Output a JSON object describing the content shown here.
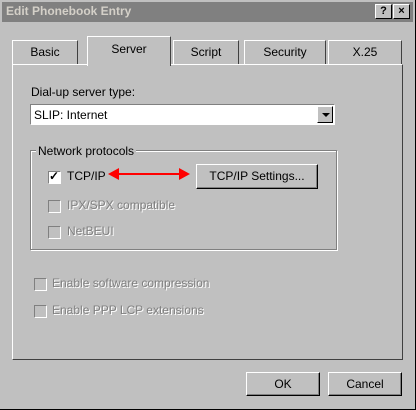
{
  "window": {
    "title": "Edit Phonebook Entry",
    "help_glyph": "?",
    "close_glyph": "×"
  },
  "tabs": [
    {
      "label": "Basic",
      "active": false
    },
    {
      "label": "Server",
      "active": true
    },
    {
      "label": "Script",
      "active": false
    },
    {
      "label": "Security",
      "active": false
    },
    {
      "label": "X.25",
      "active": false
    }
  ],
  "server": {
    "server_type_label": "Dial-up server type:",
    "server_type_value": "SLIP: Internet"
  },
  "protocols": {
    "group_label": "Network protocols",
    "tcpip": {
      "label": "TCP/IP",
      "checked": true,
      "check_glyph": "✓",
      "enabled": true
    },
    "ipxspx": {
      "label": "IPX/SPX compatible",
      "checked": false,
      "enabled": false
    },
    "netbeui": {
      "label": "NetBEUI",
      "checked": false,
      "enabled": false
    },
    "settings_button": "TCP/IP Settings..."
  },
  "options": {
    "software_compression": {
      "label": "Enable software compression",
      "checked": false,
      "enabled": false
    },
    "ppp_lcp": {
      "label": "Enable PPP LCP extensions",
      "checked": false,
      "enabled": false
    }
  },
  "buttons": {
    "ok": "OK",
    "cancel": "Cancel"
  },
  "colors": {
    "annotation_arrow": "#ff0000",
    "title_bar": "#808080",
    "face": "#c0c0c0"
  }
}
